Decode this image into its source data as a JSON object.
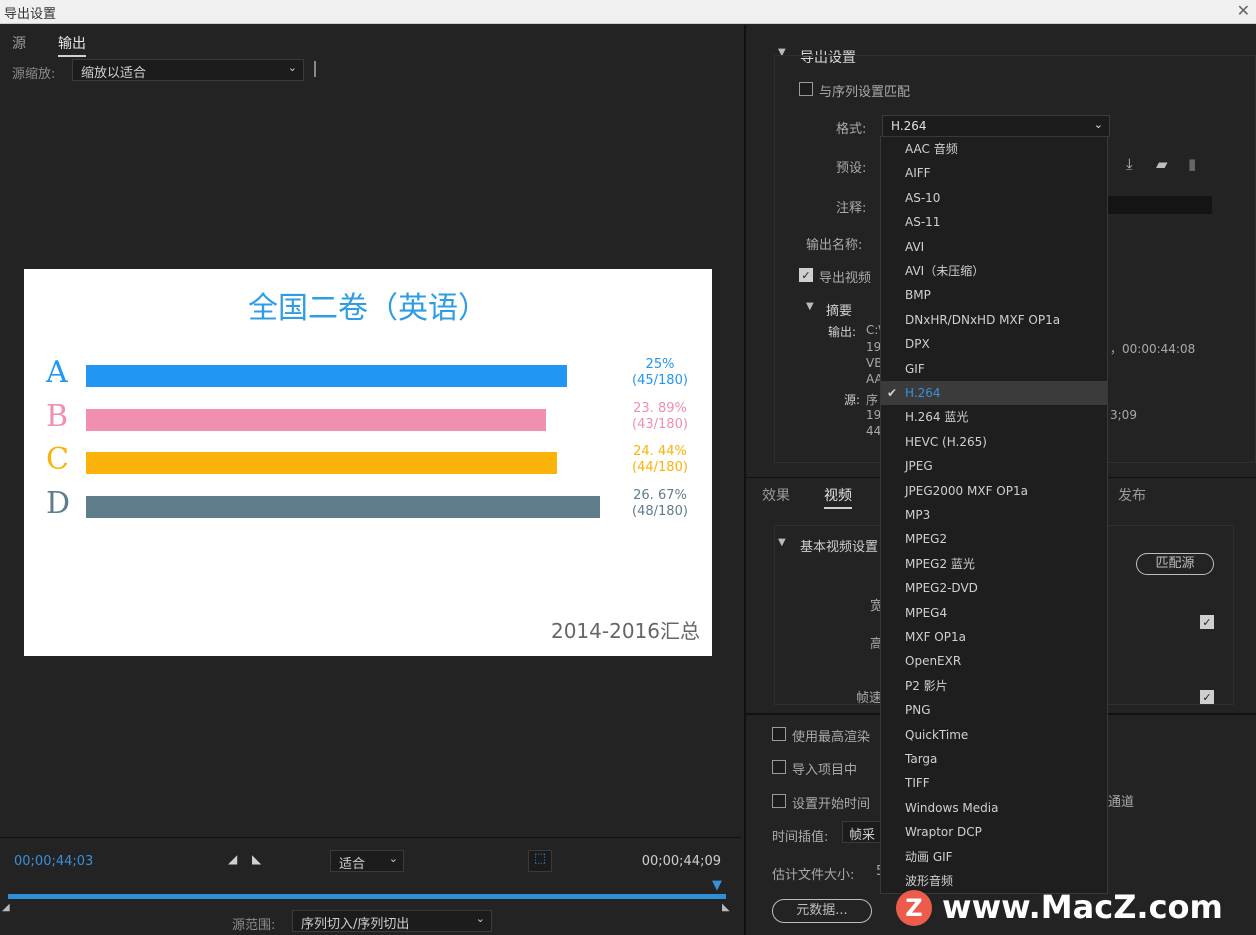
{
  "window": {
    "title": "导出设置",
    "close": "✕"
  },
  "left": {
    "tabs": [
      {
        "label": "源"
      },
      {
        "label": "输出"
      }
    ],
    "zoom_label": "源缩放:",
    "zoom_value": "缩放以适合",
    "preview": {
      "title": "全国二卷（英语）",
      "footer": "2014-2016汇总",
      "chart_data": {
        "type": "bar",
        "title": "全国二卷（英语）",
        "categories": [
          "A",
          "B",
          "C",
          "D"
        ],
        "values": [
          25,
          23.89,
          24.44,
          26.67
        ],
        "labels_pct": [
          "25%",
          "23. 89%",
          "24. 44%",
          "26. 67%"
        ],
        "labels_frac": [
          "(45/180)",
          "(43/180)",
          "(44/180)",
          "(48/180)"
        ],
        "colors": [
          "#2196f3",
          "#f08fb0",
          "#fbb20a",
          "#607d8b"
        ],
        "xlim": [
          0,
          27
        ]
      }
    },
    "timeline": {
      "timecode_in": "00;00;44;03",
      "timecode_out": "00;00;44;09",
      "fit_value": "适合",
      "range_label": "源范围:",
      "range_value": "序列切入/序列切出"
    }
  },
  "right": {
    "export_settings": {
      "header": "导出设置",
      "match_sequence": "与序列设置匹配",
      "format_label": "格式:",
      "format_value": "H.264",
      "preset_label": "预设:",
      "comment_label": "注释:",
      "output_name_label": "输出名称:",
      "export_video": "导出视频",
      "summary_header": "摘要",
      "output_label": "输出:",
      "output_lines": [
        "C:\\",
        "19",
        "VB",
        "AA"
      ],
      "output_extra": "，00:00:44:08",
      "source_label": "源:",
      "source_lines": [
        "序",
        "19",
        "44"
      ],
      "source_extra": "3;09"
    },
    "tabs": [
      {
        "label": "效果"
      },
      {
        "label": "视频"
      },
      {
        "label": "发布"
      }
    ],
    "basic_video": {
      "header": "基本视频设置",
      "match_source": "匹配源",
      "frag1": "宽",
      "frag2": "高",
      "frag3": "帧速"
    },
    "bottom": {
      "max_render": "使用最高渲染",
      "import_project": "导入项目中",
      "set_start": "设置开始时间",
      "channel_frag": "通道",
      "time_interp_label": "时间插值:",
      "time_interp_value": "帧采",
      "est_size_label": "估计文件大小:",
      "est_size_frag": "5",
      "metadata_button": "元数据..."
    }
  },
  "dropdown": {
    "selected": "H.264",
    "check": "✔",
    "items": [
      "AAC 音频",
      "AIFF",
      "AS-10",
      "AS-11",
      "AVI",
      "AVI（未压缩）",
      "BMP",
      "DNxHR/DNxHD MXF OP1a",
      "DPX",
      "GIF",
      "H.264",
      "H.264 蓝光",
      "HEVC (H.265)",
      "JPEG",
      "JPEG2000 MXF OP1a",
      "MP3",
      "MPEG2",
      "MPEG2 蓝光",
      "MPEG2-DVD",
      "MPEG4",
      "MXF OP1a",
      "OpenEXR",
      "P2 影片",
      "PNG",
      "QuickTime",
      "Targa",
      "TIFF",
      "Windows Media",
      "Wraptor DCP",
      "动画 GIF",
      "波形音频"
    ]
  },
  "watermark": {
    "logo": "Z",
    "text": "www.MacZ.com"
  }
}
